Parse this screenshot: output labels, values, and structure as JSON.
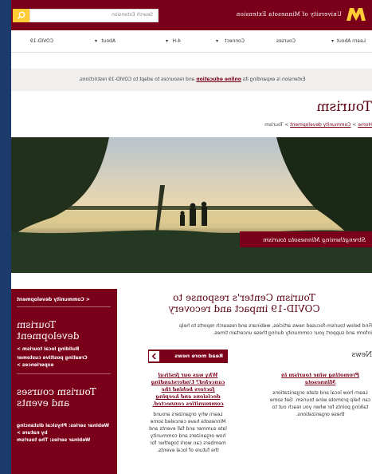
{
  "header": {
    "brand": "University of Minnesota Extension",
    "search_placeholder": "Search Extension"
  },
  "nav": {
    "items": [
      "Learn About",
      "Courses",
      "Connect",
      "4-H",
      "About",
      "COVID-19"
    ]
  },
  "notice": {
    "prefix": "Extension is expanding its ",
    "link": "online education",
    "suffix": " and resources to adapt to COVID-19 restrictions."
  },
  "page": {
    "title": "Tourism",
    "breadcrumb": {
      "home": "Home",
      "parent": "Community development",
      "current": "Tourism"
    }
  },
  "hero": {
    "caption": "Strengthening Minnesota tourism"
  },
  "covid": {
    "title": "Tourism Center's response to COVID-19 impact and recovery",
    "desc": "Find below tourism-focused news articles, webinars and research reports to help inform and support your community during these uncertain times."
  },
  "news": {
    "label": "News",
    "more_button": "Read more news",
    "articles": [
      {
        "title": "Promoting wine tourism in Minnesota",
        "body": "Learn how local and state organizations can help promote wine tourism. Get some talking points for when you reach out to these organizations."
      },
      {
        "title": "Why was our festival canceled? Understanding factors behind the decisions and keeping communities connected.",
        "body": "Learn why organizers around Minnesota have canceled some late summer and fall events and how organizers and community members can work together for the future of local events."
      }
    ]
  },
  "sidebar": {
    "back_link": "< Community development",
    "section1_title": "Tourism development",
    "section1_items": [
      "Building local tourism >",
      "Creating positive customer experiences >"
    ],
    "section2_title": "Tourism courses and events",
    "section2_items": [
      "Webinar series: Physical distancing by nature >",
      "Webinar series: The tourism"
    ]
  },
  "colors": {
    "maroon": "#7a0019",
    "gold": "#ffcc33",
    "frame": "#1c3a6b"
  }
}
